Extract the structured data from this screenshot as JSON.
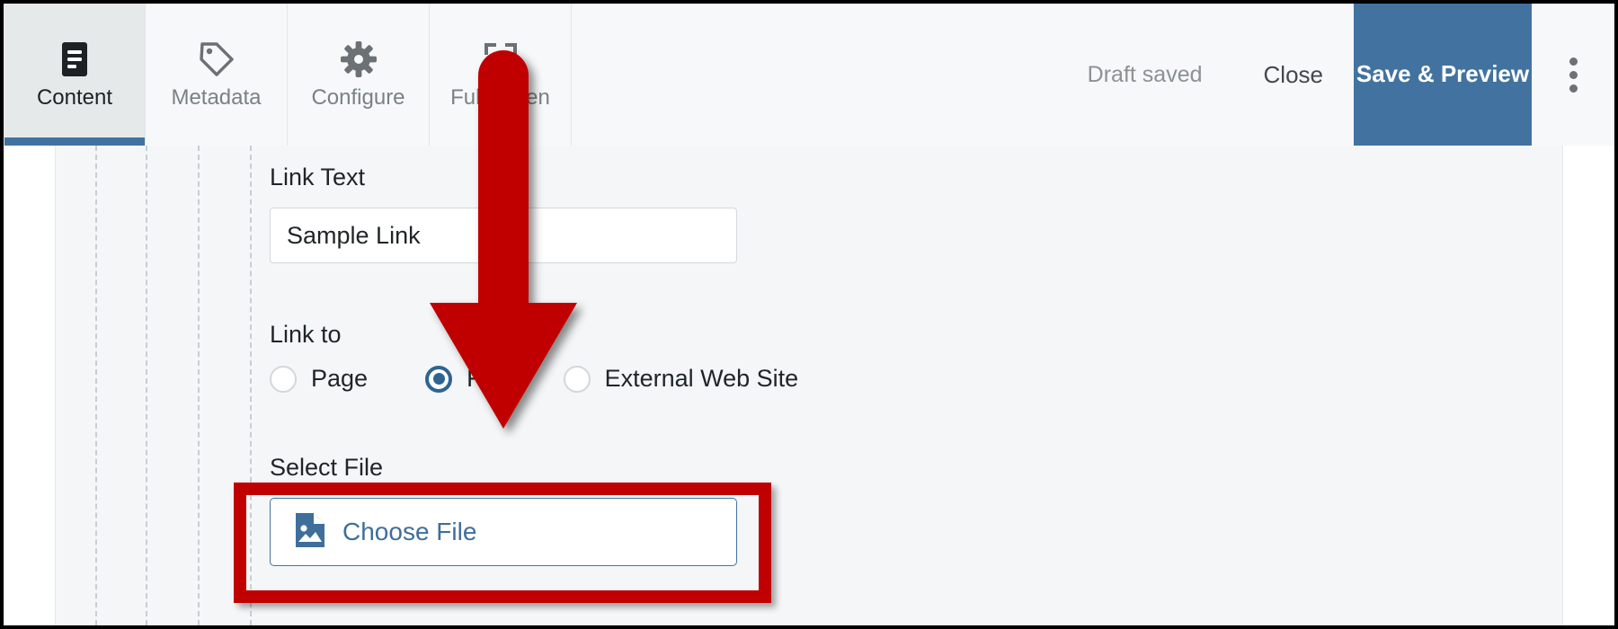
{
  "toolbar": {
    "tabs": [
      {
        "label": "Content",
        "icon": "document-lines-icon",
        "active": true
      },
      {
        "label": "Metadata",
        "icon": "tag-icon",
        "active": false
      },
      {
        "label": "Configure",
        "icon": "gear-icon",
        "active": false
      },
      {
        "label": "Fullscreen",
        "icon": "fullscreen-icon",
        "active": false
      }
    ],
    "draft_status": "Draft saved",
    "close_label": "Close",
    "save_preview_label": "Save & Preview",
    "overflow_icon": "kebab-menu-icon",
    "accent_color": "#4273a0"
  },
  "form": {
    "link_text": {
      "label": "Link Text",
      "value": "Sample Link",
      "placeholder": ""
    },
    "link_to": {
      "label": "Link to",
      "options": [
        {
          "label": "Page",
          "selected": false
        },
        {
          "label": "File",
          "selected": true
        },
        {
          "label": "External Web Site",
          "selected": false
        }
      ]
    },
    "select_file": {
      "label": "Select File",
      "button_label": "Choose File",
      "button_icon": "file-image-icon",
      "link_color": "#3f6e9b"
    }
  },
  "annotations": {
    "arrow": {
      "name": "red-down-arrow",
      "color": "#c00000"
    },
    "highlight_box": {
      "name": "red-highlight-box",
      "color": "#c00000"
    }
  }
}
